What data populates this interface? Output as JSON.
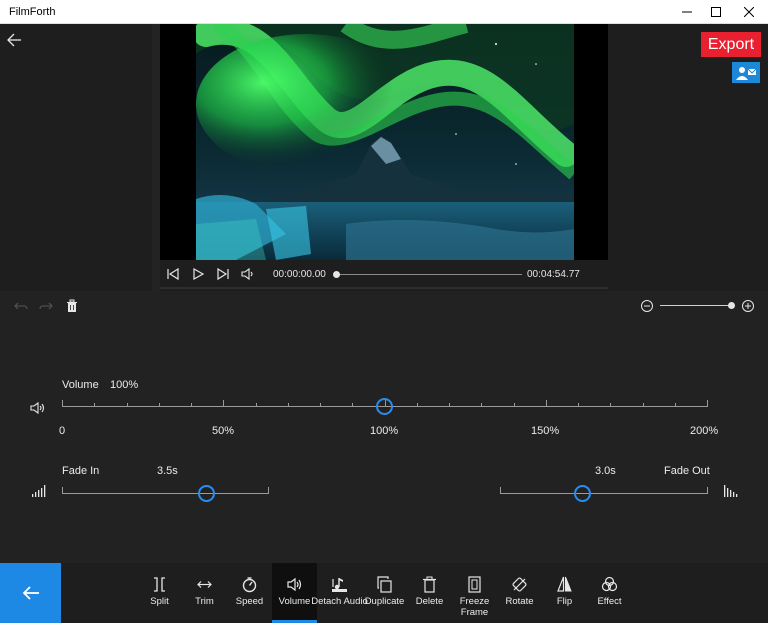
{
  "app": {
    "title": "FilmForth"
  },
  "top": {
    "export_label": "Export"
  },
  "player": {
    "current_time": "00:00:00.00",
    "total_time": "00:04:54.77",
    "progress": 0.0
  },
  "zoom": {
    "level": 1.0
  },
  "volume": {
    "label": "Volume",
    "value": "100%",
    "level_percent": 100,
    "min": 0,
    "max": 200,
    "ticks": [
      "0",
      "50%",
      "100%",
      "150%",
      "200%"
    ]
  },
  "fade_in": {
    "label": "Fade In",
    "value": "3.5s"
  },
  "fade_out": {
    "label": "Fade Out",
    "value": "3.0s"
  },
  "toolbar": {
    "active": "Volume",
    "tools": [
      {
        "id": "split",
        "label": "Split",
        "icon": "split-icon"
      },
      {
        "id": "trim",
        "label": "Trim",
        "icon": "trim-icon"
      },
      {
        "id": "speed",
        "label": "Speed",
        "icon": "speed-icon"
      },
      {
        "id": "volume",
        "label": "Volume",
        "icon": "volume-icon"
      },
      {
        "id": "detach-audio",
        "label": "Detach Audio",
        "icon": "detach-audio-icon"
      },
      {
        "id": "duplicate",
        "label": "Duplicate",
        "icon": "duplicate-icon"
      },
      {
        "id": "delete",
        "label": "Delete",
        "icon": "trash-icon"
      },
      {
        "id": "freeze-frame",
        "label": "Freeze Frame",
        "icon": "freeze-frame-icon"
      },
      {
        "id": "rotate",
        "label": "Rotate",
        "icon": "rotate-icon"
      },
      {
        "id": "flip",
        "label": "Flip",
        "icon": "flip-icon"
      },
      {
        "id": "effect",
        "label": "Effect",
        "icon": "effect-icon"
      }
    ]
  },
  "colors": {
    "accent": "#1e88e5",
    "export": "#e8202f",
    "knob": "#2a8cf0",
    "background": "#1e1e1e"
  }
}
